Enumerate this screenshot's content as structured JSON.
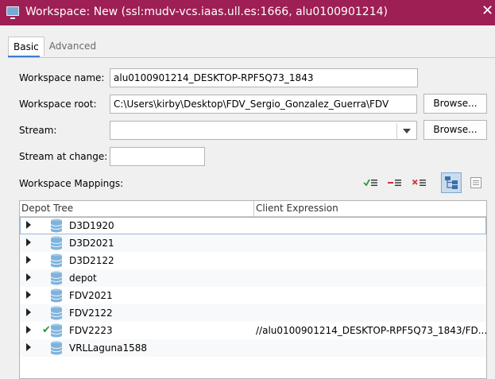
{
  "window": {
    "title": "Workspace: New (ssl:mudv-vcs.iaas.ull.es:1666,  alu0100901214)",
    "close_glyph": "✕"
  },
  "tabs": [
    {
      "label": "Basic",
      "active": true
    },
    {
      "label": "Advanced",
      "active": false
    }
  ],
  "form": {
    "workspace_name_label": "Workspace name:",
    "workspace_name_value": "alu0100901214_DESKTOP-RPF5Q73_1843",
    "workspace_root_label": "Workspace root:",
    "workspace_root_value": "C:\\Users\\kirby\\Desktop\\FDV_Sergio_Gonzalez_Guerra\\FDV",
    "stream_label": "Stream:",
    "stream_value": "",
    "stream_at_change_label": "Stream at change:",
    "stream_at_change_value": "",
    "browse_label": "Browse..."
  },
  "mappings": {
    "label": "Workspace Mappings:",
    "toolbar_icons": [
      "include-check-icon",
      "exclude-minus-icon",
      "remove-x-icon",
      "tree-view-icon",
      "text-view-icon"
    ]
  },
  "tree": {
    "columns": [
      "Depot Tree",
      "Client Expression"
    ],
    "rows": [
      {
        "name": "D3D1920",
        "expression": "",
        "mapped": false
      },
      {
        "name": "D3D2021",
        "expression": "",
        "mapped": false
      },
      {
        "name": "D3D2122",
        "expression": "",
        "mapped": false
      },
      {
        "name": "depot",
        "expression": "",
        "mapped": false
      },
      {
        "name": "FDV2021",
        "expression": "",
        "mapped": false
      },
      {
        "name": "FDV2122",
        "expression": "",
        "mapped": false
      },
      {
        "name": "FDV2223",
        "expression": "//alu0100901214_DESKTOP-RPF5Q73_1843/FD...",
        "mapped": true
      },
      {
        "name": "VRLLaguna1588",
        "expression": "",
        "mapped": false
      }
    ]
  },
  "colors": {
    "titlebar": "#9e1f54",
    "accent": "#3c7dc5",
    "mapped_check": "#2d9a3a",
    "depot_icon": "#7fb3dd"
  }
}
